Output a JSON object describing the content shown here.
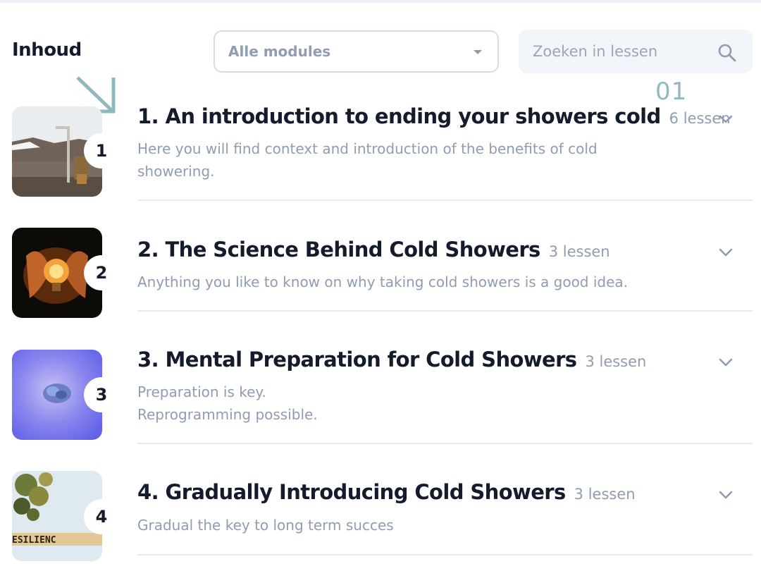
{
  "header": {
    "title": "Inhoud",
    "module_filter": {
      "selected": "Alle modules"
    },
    "search": {
      "placeholder": "Zoeken in lessen"
    }
  },
  "annotation": {
    "label": "01",
    "color": "#8fb9bf"
  },
  "modules": [
    {
      "number": "1",
      "title": "1. An introduction to ending your showers cold",
      "count": "6 lessen",
      "description": "Here you will find context and introduction of the benefits of cold\nshowering.",
      "thumbnail": "outdoor-shower-photo"
    },
    {
      "number": "2",
      "title": "2. The Science Behind Cold Showers",
      "count": "3 lessen",
      "description": "Anything you like to know on why taking cold showers is a good idea.",
      "thumbnail": "lightbulb-in-hands-photo"
    },
    {
      "number": "3",
      "title": "3. Mental Preparation for Cold Showers",
      "count": "3 lessen",
      "description": "Preparation is key.\nReprogramming possible.",
      "thumbnail": "brain-on-purple-photo"
    },
    {
      "number": "4",
      "title": "4. Gradually Introducing Cold Showers",
      "count": "3 lessen",
      "description": "Gradual the key to long term succes",
      "thumbnail": "resilience-tiles-photo",
      "thumbnail_text": "ESILIENC"
    }
  ],
  "colors": {
    "heading": "#141b2d",
    "muted": "#8f9cb1",
    "divider": "#e6ebf1",
    "search_bg": "#f2f5f9"
  }
}
